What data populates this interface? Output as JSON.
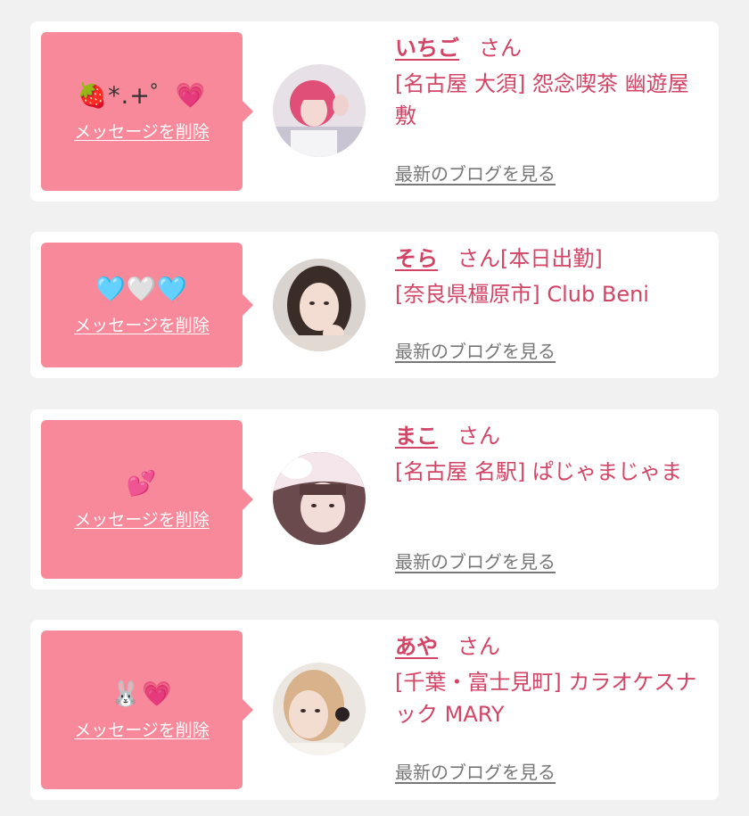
{
  "delete_label": "メッセージを削除",
  "san_label": "さん",
  "blog_label": "最新のブログを見る",
  "colors": {
    "accent": "#d24566",
    "bubble": "#f7899a",
    "background": "#f1f1f1"
  },
  "cards": [
    {
      "message": "🍓*.+゜💗",
      "name": "いちご",
      "status": "",
      "shop": "[名古屋 大須] 怨念喫茶 幽遊屋敷"
    },
    {
      "message": "🩵🤍🩵",
      "name": "そら",
      "status": "[本日出勤]",
      "shop": "[奈良県橿原市] Club Beni"
    },
    {
      "message": "💕",
      "name": "まこ",
      "status": "",
      "shop": "[名古屋 名駅] ぱじゃまじゃま"
    },
    {
      "message": "🐰💗",
      "name": "あや",
      "status": "",
      "shop": "[千葉・富士見町] カラオケスナック MARY"
    }
  ]
}
